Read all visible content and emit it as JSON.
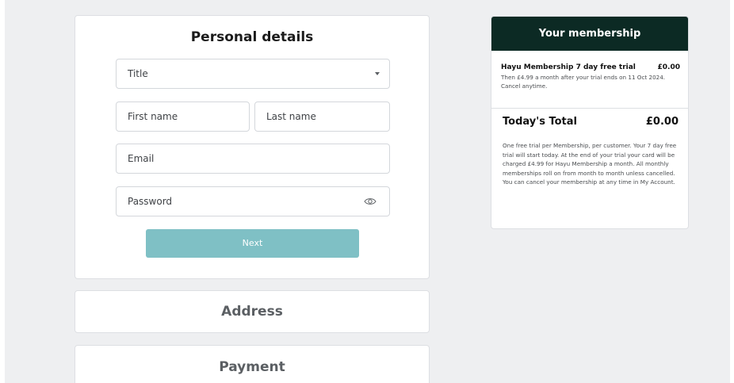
{
  "personal_details": {
    "title": "Personal details",
    "title_select": {
      "label": "Title"
    },
    "first_name": {
      "placeholder": "First name"
    },
    "last_name": {
      "placeholder": "Last name"
    },
    "email": {
      "placeholder": "Email"
    },
    "password": {
      "placeholder": "Password"
    },
    "next_label": "Next"
  },
  "address": {
    "title": "Address"
  },
  "payment": {
    "title": "Payment"
  },
  "membership": {
    "header": "Your membership",
    "plan_name": "Hayu Membership 7 day free trial",
    "plan_price": "£0.00",
    "plan_description": "Then £4.99 a month after your trial ends on 11 Oct 2024. Cancel anytime.",
    "total_label": "Today's Total",
    "total_value": "£0.00",
    "terms": "One free trial per Membership, per customer. Your 7 day free trial will start today. At the end of your trial your card will be charged £4.99 for Hayu Membership a month. All monthly memberships roll on from month to month unless cancelled. You can cancel your membership at any time in My Account."
  },
  "icons": {
    "title_dropdown": "chevron-down-icon",
    "password_visibility": "eye-icon"
  },
  "colors": {
    "page_background": "#eeeff1",
    "membership_header": "#0c2a24",
    "next_button": "#7fc0c5"
  }
}
